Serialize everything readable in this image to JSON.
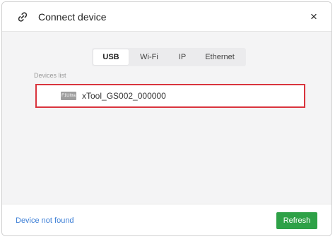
{
  "dialog": {
    "title": "Connect device",
    "title_icon": "link-icon",
    "close_glyph": "×"
  },
  "tabs": [
    {
      "label": "USB",
      "active": true
    },
    {
      "label": "Wi-Fi",
      "active": false
    },
    {
      "label": "IP",
      "active": false
    },
    {
      "label": "Ethernet",
      "active": false
    }
  ],
  "devices": {
    "label": "Devices list",
    "items": [
      {
        "badge": "F1Ultra",
        "name": "xTool_GS002_000000",
        "selected": true
      }
    ]
  },
  "footer": {
    "not_found_link": "Device not found",
    "refresh_label": "Refresh"
  },
  "colors": {
    "accent_green": "#2ea147",
    "link_blue": "#3d7fd6",
    "highlight_red": "#d9343d"
  }
}
